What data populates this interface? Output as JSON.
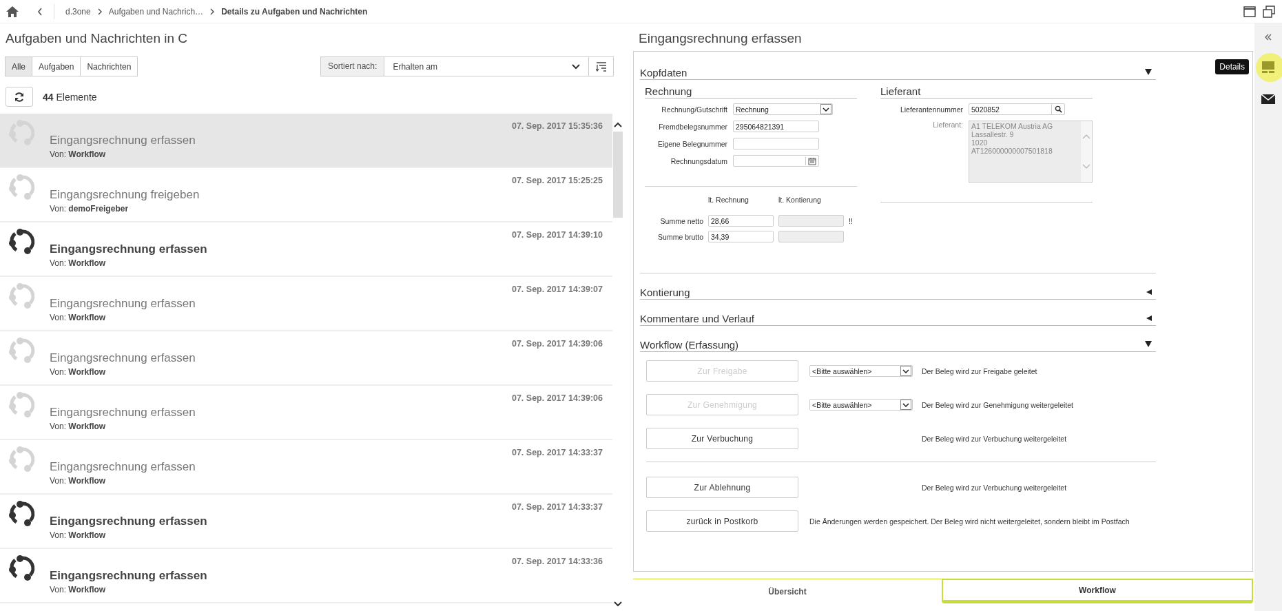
{
  "breadcrumb": [
    "d.3one",
    "Aufgaben und Nachrich…",
    "Details zu Aufgaben und Nachrichten"
  ],
  "list_panel": {
    "title": "Aufgaben und Nachrichten in C",
    "filters": [
      {
        "label": "Alle",
        "selected": true
      },
      {
        "label": "Aufgaben",
        "selected": false
      },
      {
        "label": "Nachrichten",
        "selected": false
      }
    ],
    "sort_label": "Sortiert nach:",
    "sort_value": "Erhalten am",
    "count": "**44** Elemente",
    "items": [
      {
        "date": "07. Sep. 2017 15:35:36",
        "title": "Eingangsrechnung erfassen",
        "sender": "Von: **Workflow**",
        "unread": false,
        "selected": true
      },
      {
        "date": "07. Sep. 2017 15:25:25",
        "title": "Eingangsrechnung freigeben",
        "sender": "Von: **demoFreigeber**",
        "unread": false,
        "selected": false
      },
      {
        "date": "07. Sep. 2017 14:39:10",
        "title": "Eingangsrechnung erfassen",
        "sender": "Von: **Workflow**",
        "unread": true,
        "selected": false
      },
      {
        "date": "07. Sep. 2017 14:39:07",
        "title": "Eingangsrechnung erfassen",
        "sender": "Von: **Workflow**",
        "unread": false,
        "selected": false
      },
      {
        "date": "07. Sep. 2017 14:39:06",
        "title": "Eingangsrechnung erfassen",
        "sender": "Von: **Workflow**",
        "unread": false,
        "selected": false
      },
      {
        "date": "07. Sep. 2017 14:39:06",
        "title": "Eingangsrechnung erfassen",
        "sender": "Von: **Workflow**",
        "unread": false,
        "selected": false
      },
      {
        "date": "07. Sep. 2017 14:33:37",
        "title": "Eingangsrechnung erfassen",
        "sender": "Von: **Workflow**",
        "unread": false,
        "selected": false
      },
      {
        "date": "07. Sep. 2017 14:33:37",
        "title": "Eingangsrechnung erfassen",
        "sender": "Von: **Workflow**",
        "unread": true,
        "selected": false
      },
      {
        "date": "07. Sep. 2017 14:33:36",
        "title": "Eingangsrechnung erfassen",
        "sender": "Von: **Workflow**",
        "unread": true,
        "selected": false
      }
    ]
  },
  "detail": {
    "title": "Eingangsrechnung erfassen",
    "kopfdaten": {
      "title": "Kopfdaten",
      "expanded": true,
      "rechnung": {
        "title": "Rechnung",
        "fields": [
          {
            "label": "Rechnung/Gutschrift",
            "kind": "select",
            "value": "Rechnung"
          },
          {
            "label": "Fremdbelegsnummer",
            "kind": "text",
            "value": "295064821391"
          },
          {
            "label": "Eigene Belegnummer",
            "kind": "text"
          },
          {
            "label": "Rechnungsdatum",
            "kind": "date"
          }
        ]
      },
      "lieferant": {
        "title": "Lieferant",
        "number_label": "Lieferantennummer",
        "number": "5020852",
        "address_label": "Lieferant:",
        "address": [
          "A1 TELEKOM Austria AG",
          "Lassallestr. 9",
          "1020",
          "AT126000000007501818"
        ]
      },
      "sums": {
        "columns": [
          "lt. Rechnung",
          "lt. Kontierung"
        ],
        "rows": [
          {
            "label": "Summe netto",
            "value": "28,66",
            "flag": "!!"
          },
          {
            "label": "Summe brutto",
            "value": "34,39"
          }
        ]
      }
    },
    "sections": [
      {
        "title": "Kontierung",
        "expanded": false
      },
      {
        "title": "Kommentare und Verlauf",
        "expanded": false
      }
    ],
    "workflow": {
      "title": "Workflow (Erfassung)",
      "expanded": true,
      "actions": [
        {
          "label": "Zur Freigabe",
          "disabled": true,
          "select": "<Bitte auswählen>",
          "note": "Der Beleg wird zur Freigabe geleitet"
        },
        {
          "label": "Zur Genehmigung",
          "disabled": true,
          "select": "<Bitte auswählen>",
          "note": "Der Beleg wird zur Genehmigung weitergeleitet"
        },
        {
          "label": "Zur Verbuchung",
          "disabled": false,
          "note": "Der Beleg wird zur Verbuchung weitergeleitet"
        }
      ],
      "extra_actions": [
        {
          "label": "Zur Ablehnung",
          "disabled": false,
          "note": "Der Beleg wird zur Verbuchung weitergeleitet"
        },
        {
          "label": "zurück in Postkorb",
          "disabled": false,
          "note": "Die Änderungen werden gespeichert. Der Beleg wird nicht weitergeleitet, sondern bleibt im Postfach"
        }
      ]
    },
    "tabs": [
      {
        "label": "Übersicht",
        "selected": false
      },
      {
        "label": "Workflow",
        "selected": true
      }
    ]
  },
  "sidebar": {
    "tooltip": "Details"
  }
}
